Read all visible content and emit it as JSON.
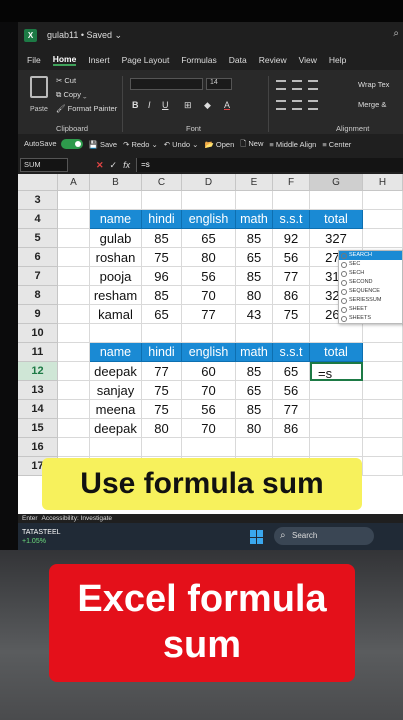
{
  "window": {
    "title": "gulab11 • Saved ⌄",
    "search_glyph": "⌕"
  },
  "menu": {
    "tabs": [
      "File",
      "Home",
      "Insert",
      "Page Layout",
      "Formulas",
      "Data",
      "Review",
      "View",
      "Help"
    ]
  },
  "ribbon": {
    "paste_label": "Paste",
    "cut_label": "Cut",
    "copy_label": "Copy ⌄",
    "format_painter_label": "Format Painter",
    "clipboard_group": "Clipboard",
    "font_size": "14",
    "font_group": "Font",
    "alignment_group": "Alignment",
    "wrap_text": "Wrap Tex",
    "merge": "Merge &"
  },
  "qat": {
    "autosave": "AutoSave",
    "save": "Save",
    "redo": "Redo ⌄",
    "undo": "Undo ⌄",
    "open": "Open",
    "new": "New",
    "middle_align": "Middle Align",
    "center": "Center"
  },
  "formula_bar": {
    "name_box": "SUM",
    "cancel": "✕",
    "enter": "✓",
    "fx": "fx",
    "value": "=s"
  },
  "columns": [
    "A",
    "B",
    "C",
    "D",
    "E",
    "F",
    "G",
    "H"
  ],
  "rows": [
    "3",
    "4",
    "5",
    "6",
    "7",
    "8",
    "9",
    "10",
    "11",
    "12",
    "13",
    "14",
    "15",
    "16",
    "17"
  ],
  "table1": {
    "headers": [
      "name",
      "hindi",
      "english",
      "math",
      "s.s.t",
      "total"
    ],
    "rows": [
      [
        "gulab",
        "85",
        "65",
        "85",
        "92",
        "327"
      ],
      [
        "roshan",
        "75",
        "80",
        "65",
        "56",
        "276"
      ],
      [
        "pooja",
        "96",
        "56",
        "85",
        "77",
        "314"
      ],
      [
        "resham",
        "85",
        "70",
        "80",
        "86",
        "321"
      ],
      [
        "kamal",
        "65",
        "77",
        "43",
        "75",
        "260"
      ]
    ]
  },
  "table2": {
    "headers": [
      "name",
      "hindi",
      "english",
      "math",
      "s.s.t",
      "total"
    ],
    "rows": [
      [
        "deepak",
        "77",
        "60",
        "85",
        "65",
        "=s"
      ],
      [
        "sanjay",
        "75",
        "70",
        "65",
        "56",
        ""
      ],
      [
        "meena",
        "75",
        "56",
        "85",
        "77",
        ""
      ],
      [
        "deepak",
        "80",
        "70",
        "80",
        "86",
        ""
      ]
    ]
  },
  "autocomplete": [
    "SEARCH",
    "SEC",
    "SECH",
    "SECOND",
    "SEQUENCE",
    "SERIESSUM",
    "SHEET",
    "SHEETS"
  ],
  "status": {
    "mode": "Enter",
    "accessibility": "Accessibility: Investigate"
  },
  "taskbar": {
    "stock_name": "TATASTEEL",
    "stock_change": "+1.05%",
    "search_label": "Search"
  },
  "captions": {
    "top": "Use formula sum",
    "bottom": "Excel formula sum"
  }
}
